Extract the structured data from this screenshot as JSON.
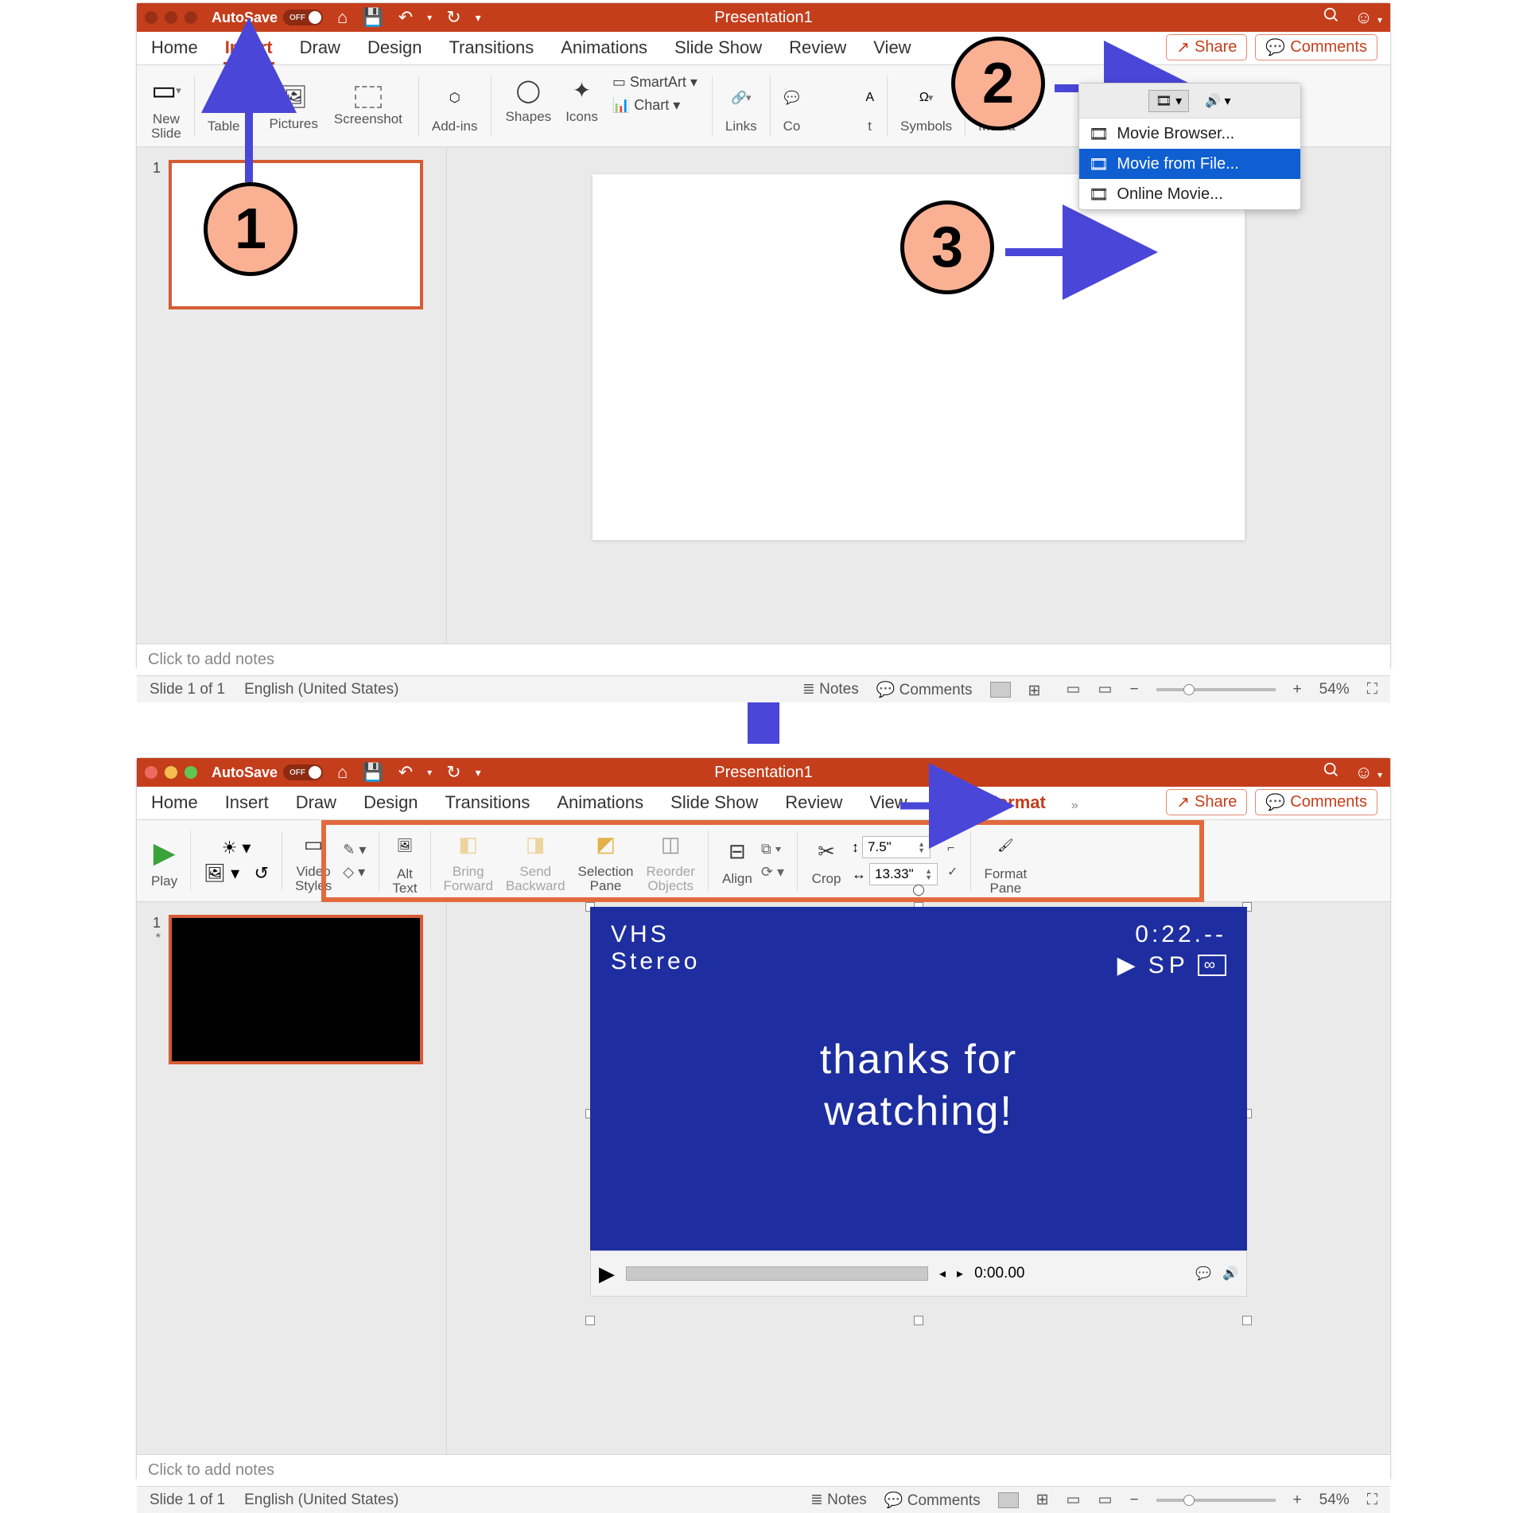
{
  "colors": {
    "accent": "#c43e1c",
    "callout": "#f9b093",
    "arrow": "#4a46d8",
    "video": "#1e2ea0"
  },
  "callouts": {
    "c1": "1",
    "c2": "2",
    "c3": "3"
  },
  "top": {
    "title": "Presentation1",
    "autosave": {
      "label": "AutoSave",
      "state": "OFF"
    },
    "titlebar_icons": [
      "home-icon",
      "save-icon",
      "undo-icon",
      "redo-icon",
      "dropdown-icon"
    ],
    "right_icons": [
      "search-icon",
      "account-icon"
    ],
    "tabs": [
      "Home",
      "Insert",
      "Draw",
      "Design",
      "Transitions",
      "Animations",
      "Slide Show",
      "Review",
      "View"
    ],
    "active_tab": "Insert",
    "share": "Share",
    "comments": "Comments",
    "ribbon": {
      "new_slide": "New\nSlide",
      "table": "Table",
      "pictures": "Pictures",
      "screenshot": "Screenshot",
      "addins": "Add-ins",
      "shapes": "Shapes",
      "icons": "Icons",
      "smartart": "SmartArt",
      "chart": "Chart",
      "links": "Links",
      "comment": "Co",
      "text": "t",
      "symbols": "Symbols",
      "media": "Media"
    },
    "dropdown": {
      "browser": "Movie Browser...",
      "file": "Movie from File...",
      "online": "Online Movie..."
    },
    "thumb_num": "1",
    "notes_placeholder": "Click to add notes",
    "status": {
      "slide": "Slide 1 of 1",
      "lang": "English (United States)",
      "notes": "Notes",
      "comments": "Comments",
      "zoom": "54%"
    }
  },
  "bottom": {
    "title": "Presentation1",
    "autosave": {
      "label": "AutoSave",
      "state": "OFF"
    },
    "tabs": [
      "Home",
      "Insert",
      "Draw",
      "Design",
      "Transitions",
      "Animations",
      "Slide Show",
      "Review",
      "View",
      "Video Format"
    ],
    "share": "Share",
    "comments": "Comments",
    "ribbon": {
      "play": "Play",
      "video_styles": "Video\nStyles",
      "alt_text": "Alt\nText",
      "bring_forward": "Bring\nForward",
      "send_backward": "Send\nBackward",
      "selection_pane": "Selection\nPane",
      "reorder": "Reorder\nObjects",
      "align": "Align",
      "crop": "Crop",
      "height": "7.5\"",
      "width": "13.33\"",
      "format_pane": "Format\nPane"
    },
    "thumb_num": "1",
    "thumb_star": "*",
    "video": {
      "vhs": "VHS",
      "stereo": "Stereo",
      "timer": "0:22.--",
      "sp": "SP",
      "msg1": "thanks for",
      "msg2": "watching!",
      "playtime": "0:00.00"
    },
    "notes_placeholder": "Click to add notes",
    "status": {
      "slide": "Slide 1 of 1",
      "lang": "English (United States)",
      "notes": "Notes",
      "comments": "Comments",
      "zoom": "54%"
    }
  }
}
